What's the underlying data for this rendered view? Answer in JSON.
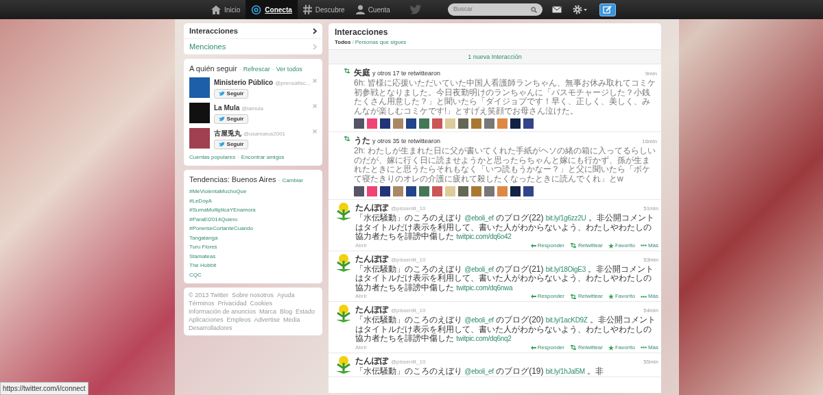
{
  "nav": {
    "items": [
      {
        "label": "Inicio",
        "selected": false
      },
      {
        "label": "Conecta",
        "selected": true
      },
      {
        "label": "Descubre",
        "selected": false
      },
      {
        "label": "Cuenta",
        "selected": false
      }
    ],
    "search": {
      "placeholder": "Buscar"
    }
  },
  "side_nav": [
    {
      "label": "Interacciones",
      "selected": true
    },
    {
      "label": "Menciones",
      "selected": false
    }
  ],
  "who_to_follow": {
    "title": "A quién seguir",
    "separator": "·",
    "links": [
      "Refrescar",
      "Ver todos"
    ],
    "accounts": [
      {
        "name": "Ministerio Público",
        "handle": "@prensafisc...",
        "button": "Seguir"
      },
      {
        "name": "La Mula",
        "handle": "@lamula",
        "button": "Seguir"
      },
      {
        "name": "古屋兎丸",
        "handle": "@usamarus2001",
        "button": "Seguir"
      }
    ],
    "footer_links": [
      "Cuentas populares",
      "Encontrar amigos"
    ]
  },
  "trends": {
    "title": "Tendencias: Buenos Aires",
    "separator": "·",
    "change": "Cambiar",
    "items": [
      "#MeViolentaMuchoQue",
      "#LeDoyA",
      "#SumaMultiplicaYEnamora",
      "#ParaEl2014Quiero",
      "#PonerseCortanteCuando",
      "Tangalanga",
      "Turu Flores",
      "Stamateas",
      "The Hobbit",
      "CQC"
    ]
  },
  "footer": [
    "© 2013 Twitter",
    "Sobre nosotros",
    "Ayuda",
    "Términos",
    "Privacidad",
    "Cookies",
    "Información de anuncios",
    "Marca",
    "Blog",
    "Estado",
    "Aplicaciones",
    "Empleos",
    "Advertise",
    "Media",
    "Desarrolladores"
  ],
  "main": {
    "title": "Interacciones",
    "filter_separator": "/",
    "filters": [
      {
        "label": "Todos",
        "selected": true
      },
      {
        "label": "Personas que sigues",
        "selected": false
      }
    ],
    "new_bar": "1 nueva Interacción",
    "items": [
      {
        "kind": "retweets",
        "name": "矢庭",
        "summary": "y otros 17 te retwittearon",
        "time": "9min",
        "text": "6h: 皆様に応援いただいていた中国人看護師ランちゃん、無事お休み取れてコミケ初参戦となりました。今日夜勤明けのランちゃんに「バスモチャージした？小銭たくさん用意した？」と聞いたら「ダイジョブです！早く、正しく、美しく、みんなが楽しむコミケです!」とすげえ笑顔でお母さん泣けた。"
      },
      {
        "kind": "retweets",
        "name": "うた",
        "summary": "y otros 35 te retwittearon",
        "time": "16min",
        "text": "2h: わたしが生まれた日に父が書いてくれた手紙がヘソの緒の箱に入ってるらしいのだが、嫁に行く日に読ませようかと思ったらちゃんと嫁にも行かず、孫が生まれたときにと思うたらそれもなく「いつ読もうかなー？」と父に聞いたら「ボケて寝たきりのオレの介護に疲れて殺したくなったときに読んでくれ」とw"
      },
      {
        "kind": "tweet",
        "name": "たんぽぽ",
        "handle": "@pissenlit_10",
        "time": "51min",
        "segments": [
          {
            "kind": "text",
            "text": "「水伝騒動」のころのえぼり "
          },
          {
            "kind": "link",
            "text": "@eboli_ef"
          },
          {
            "kind": "text",
            "text": " のブログ(22) "
          },
          {
            "kind": "link",
            "text": "bit.ly/1g6zz2U"
          },
          {
            "kind": "text",
            "text": " 。非公開コメントはタイトルだけ表示を利用して、書いた人がわからないよう、わたしやわたしの協力者たちを誹謗中傷した "
          },
          {
            "kind": "link",
            "text": "twitpic.com/dq6o42"
          }
        ],
        "open": "Abrir",
        "actions": [
          "Responder",
          "Retwittear",
          "Favorito",
          "Más"
        ]
      },
      {
        "kind": "tweet",
        "name": "たんぽぽ",
        "handle": "@pissenlit_10",
        "time": "53min",
        "segments": [
          {
            "kind": "text",
            "text": "「水伝騒動」のころのえぼり "
          },
          {
            "kind": "link",
            "text": "@eboli_ef"
          },
          {
            "kind": "text",
            "text": " のブログ(21) "
          },
          {
            "kind": "link",
            "text": "bit.ly/18OigE3"
          },
          {
            "kind": "text",
            "text": " 。非公開コメントはタイトルだけ表示を利用して、書いた人がわからないよう、わたしやわたしの協力者たちを誹謗中傷した "
          },
          {
            "kind": "link",
            "text": "twitpic.com/dq6nwa"
          }
        ],
        "open": "Abrir",
        "actions": [
          "Responder",
          "Retwittear",
          "Favorito",
          "Más"
        ]
      },
      {
        "kind": "tweet",
        "name": "たんぽぽ",
        "handle": "@pissenlit_10",
        "time": "54min",
        "segments": [
          {
            "kind": "text",
            "text": "「水伝騒動」のころのえぼり "
          },
          {
            "kind": "link",
            "text": "@eboli_ef"
          },
          {
            "kind": "text",
            "text": " のブログ(20) "
          },
          {
            "kind": "link",
            "text": "bit.ly/1acKD9Z"
          },
          {
            "kind": "text",
            "text": " 。非公開コメントはタイトルだけ表示を利用して、書いた人がわからないよう、わたしやわたしの協力者たちを誹謗中傷した "
          },
          {
            "kind": "link",
            "text": "twitpic.com/dq6nq2"
          }
        ],
        "open": "Abrir",
        "actions": [
          "Responder",
          "Retwittear",
          "Favorito",
          "Más"
        ]
      },
      {
        "kind": "tweet",
        "name": "たんぽぽ",
        "handle": "@pissenlit_10",
        "time": "55min",
        "segments": [
          {
            "kind": "text",
            "text": "「水伝騒動」のころのえぼり "
          },
          {
            "kind": "link",
            "text": "@eboli_ef"
          },
          {
            "kind": "text",
            "text": " のブログ(19) "
          },
          {
            "kind": "link",
            "text": "bit.ly/1hJal5M"
          },
          {
            "kind": "text",
            "text": " 。非"
          }
        ]
      }
    ]
  },
  "status_url": "https://twitter.com/i/connect"
}
